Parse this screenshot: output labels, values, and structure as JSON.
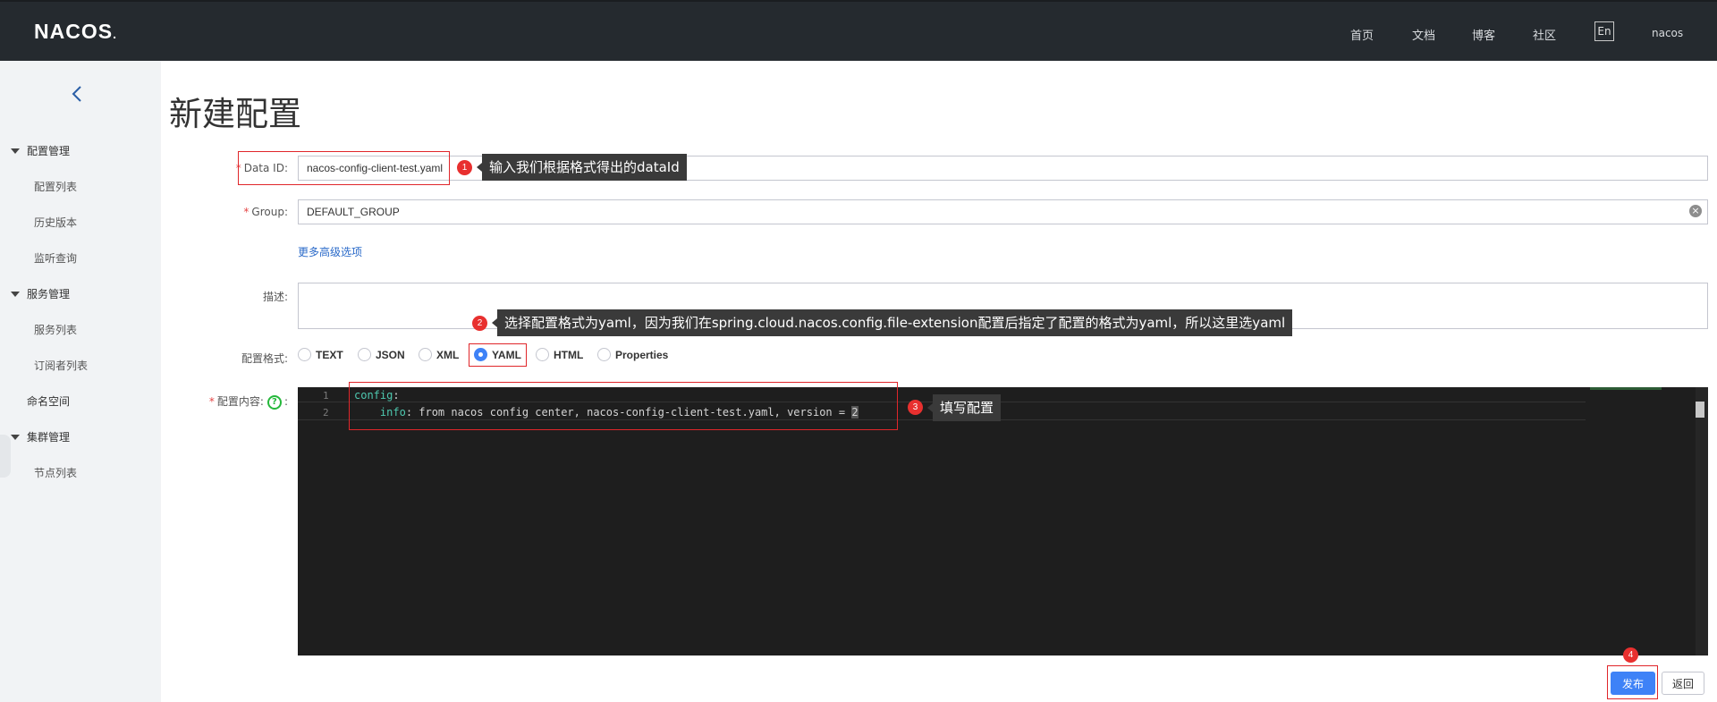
{
  "header": {
    "logo": "NACOS",
    "nav": [
      "首页",
      "文档",
      "博客",
      "社区"
    ],
    "lang": "En",
    "user": "nacos"
  },
  "sidebar": {
    "groups": [
      {
        "label": "配置管理",
        "items": [
          "配置列表",
          "历史版本",
          "监听查询"
        ]
      },
      {
        "label": "服务管理",
        "items": [
          "服务列表",
          "订阅者列表"
        ]
      }
    ],
    "namespace": "命名空间",
    "cluster": {
      "label": "集群管理",
      "items": [
        "节点列表"
      ]
    }
  },
  "page": {
    "title": "新建配置"
  },
  "form": {
    "data_id_label": "Data ID:",
    "data_id_value": "nacos-config-client-test.yaml",
    "group_label": "Group:",
    "group_value": "DEFAULT_GROUP",
    "more_options": "更多高级选项",
    "desc_label": "描述:",
    "format_label": "配置格式:",
    "formats": [
      "TEXT",
      "JSON",
      "XML",
      "YAML",
      "HTML",
      "Properties"
    ],
    "selected_format": "YAML",
    "content_label": "配置内容:",
    "content_colon": ":"
  },
  "editor": {
    "line_numbers": [
      "1",
      "2"
    ],
    "line1_key": "config",
    "line1_rest": ":",
    "line2_indent": "    ",
    "line2_key": "info",
    "line2_rest": ": from nacos config center, nacos-config-client-test.yaml, version = ",
    "line2_cursor": "2"
  },
  "annotations": {
    "tip1": "输入我们根据格式得出的dataId",
    "tip2": "选择配置格式为yaml，因为我们在spring.cloud.nacos.config.file-extension配置后指定了配置的格式为yaml，所以这里选yaml",
    "tip3": "填写配置",
    "badges": [
      "1",
      "2",
      "3",
      "4"
    ]
  },
  "actions": {
    "publish": "发布",
    "back": "返回"
  },
  "colors": {
    "header_bg": "#252a2f",
    "sidebar_bg": "#f1f3f5",
    "primary": "#3e82f7",
    "annotation_red": "#e8302f",
    "editor_bg": "#1e1e1e"
  }
}
